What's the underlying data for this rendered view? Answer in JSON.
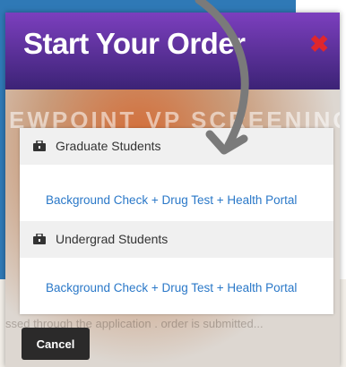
{
  "modal": {
    "title": "Start Your Order",
    "close_icon": "close-icon",
    "watermark": "EWPOINT VP SCREENING",
    "background_text": "ssed through the application\n. order is submitted...",
    "cancel_label": "Cancel"
  },
  "groups": [
    {
      "icon": "briefcase-icon",
      "label": "Graduate Students",
      "link": "Background Check + Drug Test + Health Portal"
    },
    {
      "icon": "briefcase-icon",
      "label": "Undergrad Students",
      "link": "Background Check + Drug Test + Health Portal"
    }
  ],
  "colors": {
    "header_top": "#7c3fbe",
    "header_bottom": "#3c2376",
    "close": "#e0262c",
    "link": "#2a78c8",
    "page_blue": "#2f79b6",
    "arrow": "#7a7a7a"
  }
}
